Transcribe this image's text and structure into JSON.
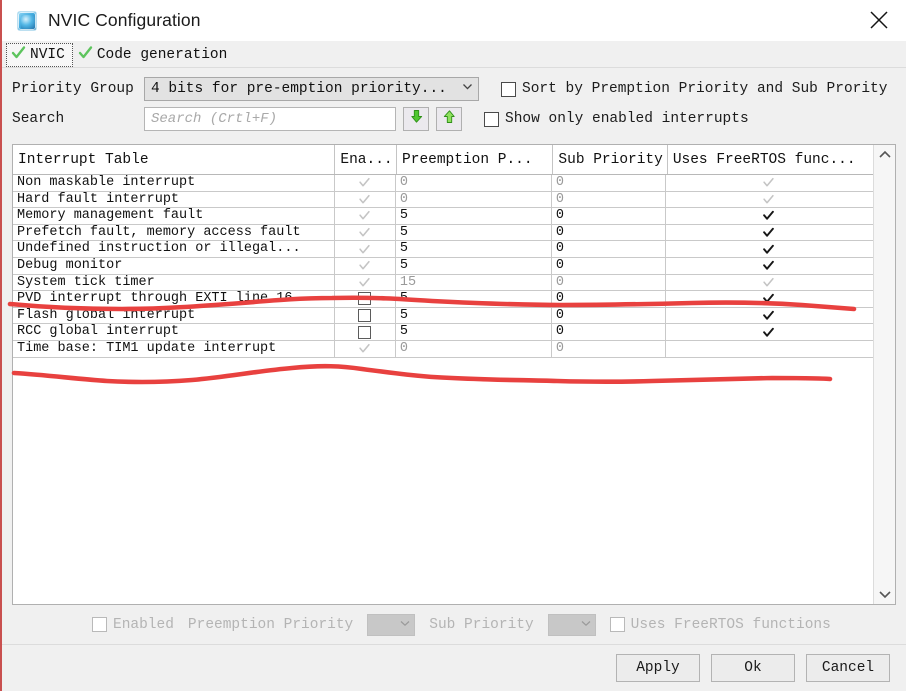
{
  "window": {
    "title": "NVIC Configuration",
    "app_icon": "cube-icon",
    "close_icon": "close-icon"
  },
  "tabs": [
    {
      "label": "NVIC",
      "icon": "green-check-icon",
      "selected": true
    },
    {
      "label": "Code generation",
      "icon": "green-check-icon",
      "selected": false
    }
  ],
  "options": {
    "priority_group_label": "Priority Group",
    "priority_group_value": "4 bits for pre-emption priority...",
    "priority_group_chevron": "chevron-down-icon",
    "search_label": "Search",
    "search_placeholder": "Search (Crtl+F)",
    "search_value": "",
    "find_next_icon": "green-down-arrow-icon",
    "find_prev_icon": "green-up-arrow-icon",
    "sort_checkbox_label": "Sort by Premption Priority and Sub Prority",
    "sort_checkbox_checked": false,
    "show_enabled_checkbox_label": "Show only enabled interrupts",
    "show_enabled_checkbox_checked": false
  },
  "table": {
    "headers": [
      "Interrupt Table",
      "Ena...",
      "Preemption P...",
      "Sub Priority",
      "Uses FreeRTOS func..."
    ],
    "rows": [
      {
        "name": "Non maskable interrupt",
        "enabled": "checked-dim",
        "preemption": "0",
        "sub": "0",
        "rtos": "checked-dim",
        "dim": true
      },
      {
        "name": "Hard fault interrupt",
        "enabled": "checked-dim",
        "preemption": "0",
        "sub": "0",
        "rtos": "checked-dim",
        "dim": true
      },
      {
        "name": "Memory management fault",
        "enabled": "checked-dim",
        "preemption": "5",
        "sub": "0",
        "rtos": "checked",
        "dim": false
      },
      {
        "name": "Prefetch fault, memory access fault",
        "enabled": "checked-dim",
        "preemption": "5",
        "sub": "0",
        "rtos": "checked",
        "dim": false
      },
      {
        "name": "Undefined instruction or illegal...",
        "enabled": "checked-dim",
        "preemption": "5",
        "sub": "0",
        "rtos": "checked",
        "dim": false
      },
      {
        "name": "Debug monitor",
        "enabled": "checked-dim",
        "preemption": "5",
        "sub": "0",
        "rtos": "checked",
        "dim": false
      },
      {
        "name": "System tick timer",
        "enabled": "checked-dim",
        "preemption": "15",
        "sub": "0",
        "rtos": "checked-dim",
        "dim": true
      },
      {
        "name": "PVD interrupt through EXTI line 16",
        "enabled": "unchecked",
        "preemption": "5",
        "sub": "0",
        "rtos": "checked",
        "dim": false
      },
      {
        "name": "Flash global interrupt",
        "enabled": "unchecked",
        "preemption": "5",
        "sub": "0",
        "rtos": "checked",
        "dim": false
      },
      {
        "name": "RCC global interrupt",
        "enabled": "unchecked",
        "preemption": "5",
        "sub": "0",
        "rtos": "checked",
        "dim": false
      },
      {
        "name": "Time base: TIM1 update interrupt",
        "enabled": "checked-dim",
        "preemption": "0",
        "sub": "0",
        "rtos": "none",
        "dim": true
      }
    ],
    "scroll_up_icon": "chevron-up-icon",
    "scroll_down_icon": "chevron-down-icon"
  },
  "detail": {
    "enabled_label": "Enabled",
    "enabled_checked": false,
    "preemption_label": "Preemption Priority",
    "preemption_value": "",
    "preemption_chevron": "chevron-down-icon",
    "sub_label": "Sub Priority",
    "sub_value": "",
    "sub_chevron": "chevron-down-icon",
    "rtos_label": "Uses FreeRTOS functions",
    "rtos_checked": false
  },
  "footer": {
    "apply_label": "Apply",
    "ok_label": "Ok",
    "cancel_label": "Cancel"
  },
  "annotations": {
    "color": "#e8413f",
    "line_1_desc": "red hand-drawn underline across System tick timer row",
    "line_2_desc": "red hand-drawn wavy line below the table rows"
  }
}
